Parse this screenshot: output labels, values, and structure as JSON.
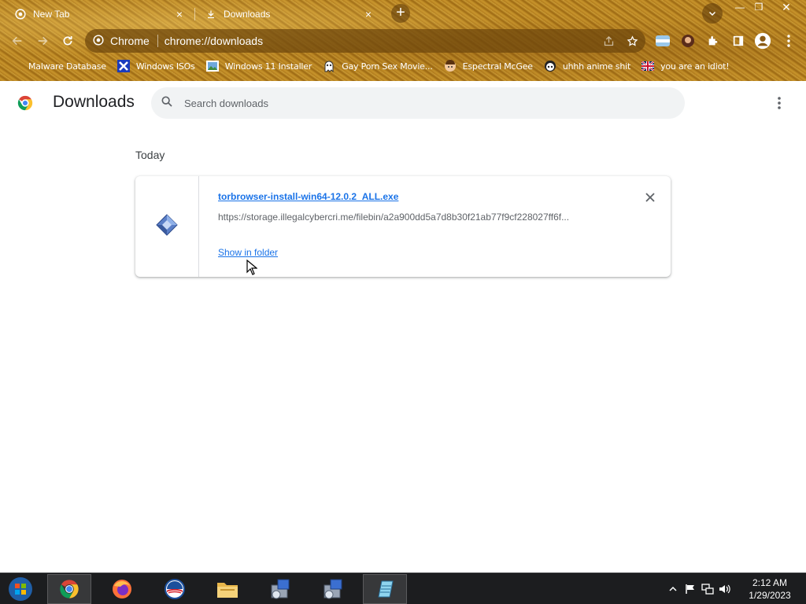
{
  "tabs": [
    {
      "title": "New Tab",
      "icon": "chrome-icon",
      "close": "×"
    },
    {
      "title": "Downloads",
      "icon": "download-icon",
      "close": "×"
    }
  ],
  "new_tab_symbol": "+",
  "window_controls": {
    "minimize": "—",
    "maximize": "❐",
    "close": "✕"
  },
  "omnibox": {
    "site": "Chrome",
    "url": "chrome://downloads"
  },
  "bookmarks": [
    {
      "label": "Malware Database",
      "icon": "blank-page-icon"
    },
    {
      "label": "Windows ISOs",
      "icon": "x-logo-icon"
    },
    {
      "label": "Windows 11 Installer",
      "icon": "image-icon"
    },
    {
      "label": "Gay Porn Sex Movie...",
      "icon": "ghost-icon"
    },
    {
      "label": "Espectral McGee",
      "icon": "face-icon"
    },
    {
      "label": "uhhh anime shit",
      "icon": "anime-icon"
    },
    {
      "label": "you are an idiot!",
      "icon": "flag-icon"
    }
  ],
  "page": {
    "title": "Downloads",
    "search_placeholder": "Search downloads",
    "date_header": "Today"
  },
  "download": {
    "filename": "torbrowser-install-win64-12.0.2_ALL.exe",
    "url": "https://storage.illegalcybercri.me/filebin/a2a900dd5a7d8b30f21ab77f9cf228027ff6f...",
    "action": "Show in folder",
    "remove": "×"
  },
  "taskbar": {
    "apps": [
      "chrome-icon",
      "firefox-icon",
      "obama-logo-icon",
      "file-explorer-icon",
      "installer-icon",
      "installer-icon",
      "notepad-icon"
    ]
  },
  "clock": {
    "time": "2:12 AM",
    "date": "1/29/2023"
  },
  "colors": {
    "accent": "#1a73e8",
    "theme_gold": "#b5801f",
    "taskbar": "#1c1d1f"
  }
}
